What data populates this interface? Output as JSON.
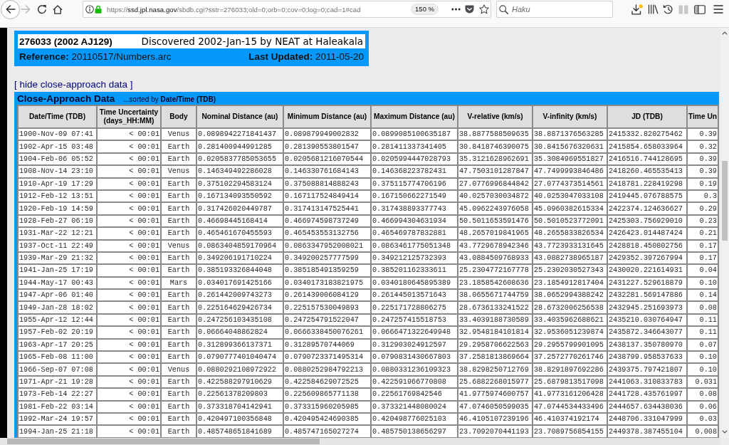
{
  "browser": {
    "forward": {
      "disabled": true
    },
    "url": {
      "scheme": "https://",
      "host": "ssd.jpl.nasa.gov",
      "path": "/sbdb.cgi?sstr=276033;old=0;orb=0;cov=0;log=0;cad=1#cad"
    },
    "zoom": "150 %",
    "search": {
      "placeholder": "Haku"
    },
    "downloads": {
      "attention": true
    }
  },
  "summary": {
    "designation": "276033 (2002 AJ129)",
    "discovery": "Discovered 2002-Jan-15 by NEAT at Haleakala",
    "reference": "**Reference:** 20110517/Numbers.arc",
    "updated": "**Last Updated:** 2011-05-20"
  },
  "toggle_link": "[ hide close-approach data ]",
  "close_approach": {
    "title": "Close-Approach Data",
    "sort_note": "...sorted by **Date/Time (TDB)**",
    "columns": [
      "Date/Time (TDB)",
      "Time Uncertainty (days_HH:MM)",
      "Body",
      "Nominal Distance (au)",
      "Minimum Distance (au)",
      "Maximum Distance (au)",
      "V-relative (km/s)",
      "V-infinity (km/s)",
      "JD (TDB)",
      "Time Un"
    ],
    "rows": [
      [
        "1900-Nov-09 07:41",
        "< 00:01",
        "Venus",
        "0.0898942271841437",
        "0.089879949002832",
        "0.0899085100635187",
        "38.8877588509635",
        "38.8871376563285",
        "2415332.820275462",
        "0.39"
      ],
      [
        "1902-Apr-15 03:48",
        "< 00:01",
        "Earth",
        "0.281400944991285",
        "0.281390553801547",
        "0.281411337341405",
        "30.8418746390075",
        "30.8415676320631",
        "2415854.658033964",
        "0.32"
      ],
      [
        "1904-Feb-06 05:52",
        "< 00:01",
        "Earth",
        "0.0205837785053655",
        "0.0205681216070544",
        "0.0205994447028793",
        "35.3121628962691",
        "35.3084969551827",
        "2416516.744128695",
        "0.39"
      ],
      [
        "1908-Nov-14 23:10",
        "< 00:01",
        "Venus",
        "0.146349492286028",
        "0.146330761684143",
        "0.146368223782431",
        "47.7503101287847",
        "47.7499993846486",
        "2418260.465535413",
        "0.39"
      ],
      [
        "1910-Apr-19 17:29",
        "< 00:01",
        "Earth",
        "0.375102294583124",
        "0.375088814888243",
        "0.375115774706196",
        "27.0776996844842",
        "27.0774373514561",
        "2418781.228419298",
        "0.19"
      ],
      [
        "1912-Feb-12 13:51",
        "< 00:01",
        "Earth",
        "0.167134093550592",
        "0.167117524849414",
        "0.167150662271549",
        "40.0257030034872",
        "40.0253047033108",
        "2419445.076788575",
        "0.3"
      ],
      [
        "1920-Feb-19 14:59",
        "< 00:01",
        "Earth",
        "0.317426020449787",
        "0.317413147525441",
        "0.317438893377743",
        "45.0962243976058",
        "45.0960382615334",
        "2422374.124636627",
        "0.29"
      ],
      [
        "1928-Feb-27 06:10",
        "< 00:01",
        "Earth",
        "0.46698445168414",
        "0.466974598737249",
        "0.466994304631934",
        "50.5011653591476",
        "50.5010523772091",
        "2425303.756929010",
        "0.23"
      ],
      [
        "1931-Mar-22 12:21",
        "< 00:01",
        "Earth",
        "0.465461670455593",
        "0.465453553132756",
        "0.465469787832881",
        "48.2657019841965",
        "48.2655833826534",
        "2426423.014487424",
        "0.21"
      ],
      [
        "1937-Oct-11 22:49",
        "< 00:01",
        "Venus",
        "0.0863404859170964",
        "0.0863347952008021",
        "0.0863461775051348",
        "43.7729678942346",
        "43.7723933131645",
        "2428818.450802756",
        "0.17"
      ],
      [
        "1939-Mar-29 21:32",
        "< 00:01",
        "Earth",
        "0.349206191710224",
        "0.349200257777599",
        "0.349212125732393",
        "43.0884509768933",
        "43.0882738965187",
        "2429352.397267994",
        "0.17"
      ],
      [
        "1941-Jan-25 17:19",
        "< 00:01",
        "Earth",
        "0.385193326844048",
        "0.385185491359259",
        "0.385201162333611",
        "25.2304772167778",
        "25.2302030527343",
        "2430020.221614931",
        "0.04"
      ],
      [
        "1944-May-17 00:43",
        "< 00:01",
        "Mars",
        "0.034017691425166",
        "0.0340173183821975",
        "0.0340180645895389",
        "23.1858542608636",
        "23.1854912817404",
        "2431227.529618879",
        "0.10"
      ],
      [
        "1947-Apr-06 01:40",
        "< 00:01",
        "Earth",
        "0.261442009743273",
        "0.261439006084129",
        "0.261445013571643",
        "38.0655671744759",
        "38.0652994388242",
        "2432281.569147886",
        "0.14"
      ],
      [
        "1949-Jan-28 18:02",
        "< 00:01",
        "Earth",
        "0.225164629426734",
        "0.225157530049893",
        "0.225171728806275",
        "28.6736133241522",
        "28.6732006256538",
        "2432945.251693973",
        "0.08"
      ],
      [
        "1955-Apr-12 12:44",
        "< 00:01",
        "Earth",
        "0.247256103435108",
        "0.247254791522047",
        "0.247257415518753",
        "33.4039188730589",
        "33.4035962688621",
        "2435210.030764947",
        "0.11"
      ],
      [
        "1957-Feb-02 20:19",
        "< 00:01",
        "Earth",
        "0.06664048862824",
        "0.0666338450076261",
        "0.0666471322649948",
        "32.9548184101814",
        "32.9536051239874",
        "2435872.346643077",
        "0.11"
      ],
      [
        "1963-Apr-17 20:25",
        "< 00:01",
        "Earth",
        "0.312899366137371",
        "0.31289570744069",
        "0.312903024912597",
        "29.2958706622563",
        "29.2955799901095",
        "2438137.350780970",
        "0.07"
      ],
      [
        "1965-Feb-08 11:00",
        "< 00:01",
        "Earth",
        "0.0790777401040474",
        "0.0790723371495314",
        "0.0790831430667803",
        "37.2581813869664",
        "37.2572770261746",
        "2438799.958537633",
        "0.10"
      ],
      [
        "1966-Sep-07 07:08",
        "< 00:01",
        "Venus",
        "0.0880292108972922",
        "0.0880252984792213",
        "0.0880331236109323",
        "38.8298250712769",
        "38.8291897692286",
        "2439375.797421807",
        "0.10"
      ],
      [
        "1971-Apr-21 19:28",
        "< 00:01",
        "Earth",
        "0.422588297910629",
        "0.422584629072525",
        "0.422591966770808",
        "25.6882268015977",
        "25.6879813517098",
        "2441063.310833783",
        "0.031"
      ],
      [
        "1973-Feb-14 22:27",
        "< 00:01",
        "Earth",
        "0.22561378209803",
        "0.225609865771138",
        "0.22561769842546",
        "41.9775974600757",
        "41.9773161206428",
        "2441728.435761997",
        "0.08"
      ],
      [
        "1981-Feb-22 03:14",
        "< 00:01",
        "Earth",
        "0.373318704142941",
        "0.373315960205985",
        "0.373321448080024",
        "47.0746050599035",
        "47.0744534433496",
        "2444657.634438036",
        "0.06"
      ],
      [
        "1992-Mar-24 19:57",
        "< 00:01",
        "Earth",
        "0.420497100356848",
        "0.420495424690385",
        "0.420498776025103",
        "46.4105107239196",
        "46.410374192174",
        "2448706.331047999",
        "0.03"
      ],
      [
        "1994-Jan-25 21:18",
        "< 00:01",
        "Earth",
        "0.485748651841689",
        "0.485747165027274",
        "0.485750138656297",
        "23.7092070441193",
        "23.7089756854155",
        "2449378.387455104",
        "0.008"
      ]
    ]
  }
}
